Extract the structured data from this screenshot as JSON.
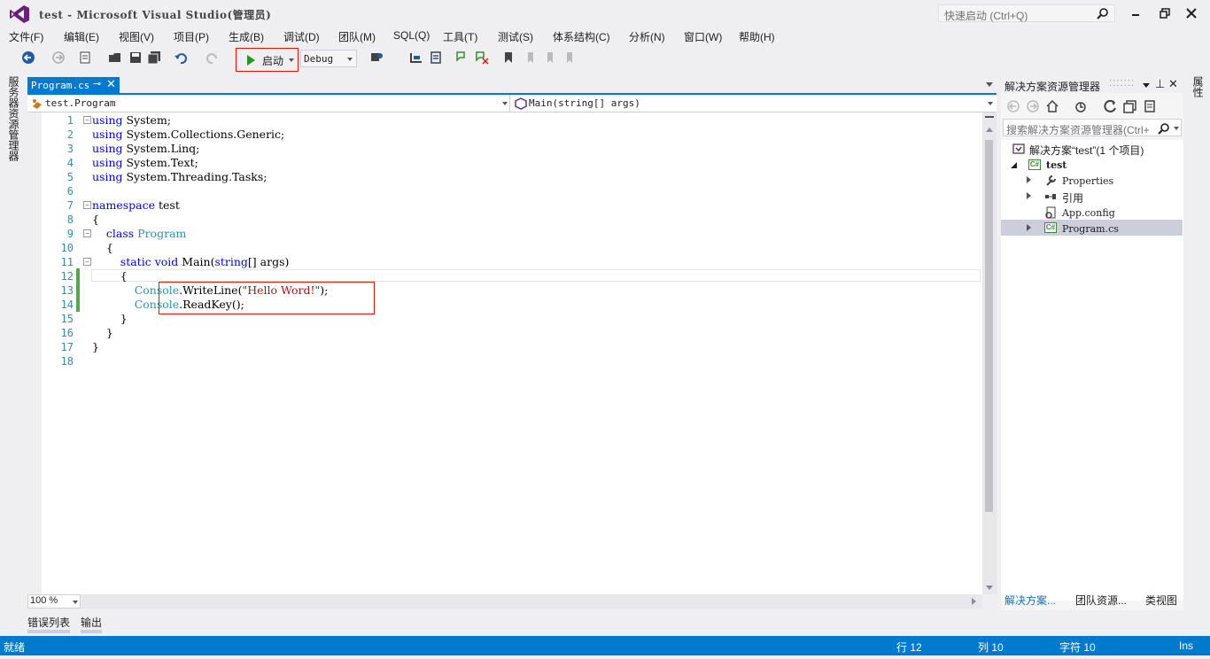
{
  "window": {
    "title": "test - Microsoft Visual Studio(管理员)",
    "quick_launch_placeholder": "快速启动 (Ctrl+Q)"
  },
  "menu": [
    "文件(F)",
    "编辑(E)",
    "视图(V)",
    "项目(P)",
    "生成(B)",
    "调试(D)",
    "团队(M)",
    "SQL(Q)",
    "工具(T)",
    "测试(S)",
    "体系结构(C)",
    "分析(N)",
    "窗口(W)",
    "帮助(H)"
  ],
  "toolbar": {
    "start_label": "启动",
    "config": "Debug"
  },
  "side_tabs": {
    "left": "服务器资源管理器",
    "right": "属性"
  },
  "editor": {
    "tab_label": "Program.cs",
    "nav_left": "test.Program",
    "nav_right": "Main(string[] args)",
    "zoom": "100 %",
    "line_numbers": [
      "1",
      "2",
      "3",
      "4",
      "5",
      "6",
      "7",
      "8",
      "9",
      "10",
      "11",
      "12",
      "13",
      "14",
      "15",
      "16",
      "17",
      "18"
    ]
  },
  "bottom_tabs": [
    "错误列表",
    "输出"
  ],
  "status": {
    "ready": "就绪",
    "line": "行 12",
    "col": "列 10",
    "char": "字符 10",
    "mode": "Ins"
  },
  "solution_explorer": {
    "title": "解决方案资源管理器",
    "search_placeholder": "搜索解决方案资源管理器(Ctrl+",
    "solution_label": "解决方案“test”(1 个项目)",
    "project": "test",
    "items": [
      "Properties",
      "引用",
      "App.config",
      "Program.cs"
    ],
    "bottom_tabs": [
      "解决方案...",
      "团队资源...",
      "类视图"
    ]
  },
  "colors": {
    "accent": "#007ACC",
    "keyword": "#0000FF",
    "type": "#2B91AF",
    "string": "#A31515",
    "highlight_box": "#E51400"
  }
}
